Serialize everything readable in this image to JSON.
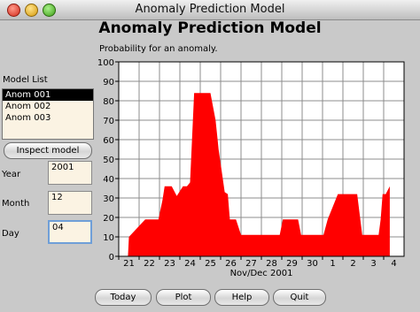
{
  "window": {
    "title": "Anomaly Prediction Model"
  },
  "header": {
    "title": "Anomaly Prediction Model"
  },
  "chart_label": "Probability for an anomaly.",
  "model_list": {
    "label": "Model List",
    "items": [
      "Anom 001",
      "Anom 002",
      "Anom 003"
    ],
    "selected_index": 0
  },
  "inspect_button": "Inspect model",
  "fields": {
    "year": {
      "label": "Year",
      "value": "2001"
    },
    "month": {
      "label": "Month",
      "value": "12"
    },
    "day": {
      "label": "Day",
      "value": "04"
    }
  },
  "buttons": {
    "today": "Today",
    "plot": "Plot",
    "help": "Help",
    "quit": "Quit"
  },
  "chart_data": {
    "type": "area",
    "title": "Probability for an anomaly.",
    "xlabel": "Nov/Dec 2001",
    "ylabel": "",
    "ylim": [
      0,
      100
    ],
    "yticks": [
      0,
      10,
      20,
      30,
      40,
      50,
      60,
      70,
      80,
      90,
      100
    ],
    "xlim": [
      0,
      14
    ],
    "xticks": [
      "21",
      "22",
      "23",
      "24",
      "25",
      "26",
      "27",
      "28",
      "29",
      "30",
      "1",
      "2",
      "3",
      "4"
    ],
    "grid": true,
    "color": "#ff0000",
    "x": [
      0.45,
      0.5,
      1.3,
      1.45,
      1.6,
      1.95,
      2.15,
      2.25,
      2.6,
      2.85,
      3.15,
      3.35,
      3.5,
      3.7,
      4.5,
      4.75,
      4.85,
      4.9,
      5.2,
      5.35,
      5.45,
      5.55,
      5.75,
      6.0,
      6.15,
      6.35,
      7.1,
      7.4,
      7.9,
      8.05,
      8.2,
      8.8,
      8.95,
      9.85,
      10.05,
      10.25,
      10.75,
      10.9,
      11.7,
      11.95,
      12.05,
      12.55,
      12.75,
      12.85,
      12.95,
      13.1,
      13.3
    ],
    "y": [
      0,
      10,
      19,
      19,
      19,
      19,
      29,
      36,
      36,
      31,
      36,
      36,
      38,
      84,
      84,
      70,
      60,
      55,
      33,
      32,
      19,
      19,
      19,
      11,
      11,
      11,
      11,
      11,
      11,
      19,
      19,
      19,
      11,
      11,
      11,
      19,
      32,
      32,
      32,
      11,
      11,
      11,
      11,
      19,
      32,
      32,
      36
    ]
  }
}
